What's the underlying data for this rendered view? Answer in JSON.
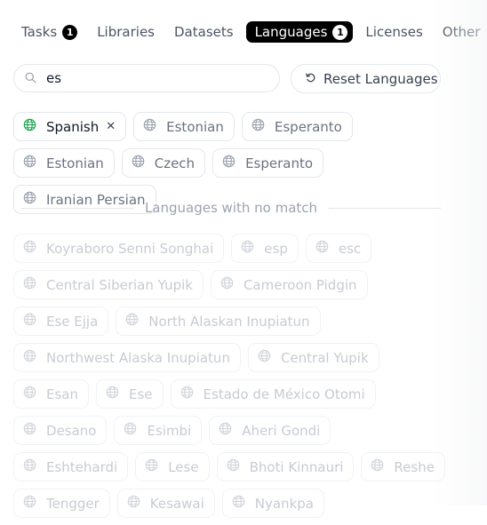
{
  "tabs": [
    {
      "label": "Tasks",
      "badge": "1",
      "active": false
    },
    {
      "label": "Libraries",
      "active": false
    },
    {
      "label": "Datasets",
      "active": false
    },
    {
      "label": "Languages",
      "badge": "1",
      "active": true
    },
    {
      "label": "Licenses",
      "active": false
    },
    {
      "label": "Other",
      "active": false
    }
  ],
  "search": {
    "value": "es",
    "icon": "search-icon"
  },
  "reset_button": {
    "label": "Reset Languages",
    "icon": "reset-icon"
  },
  "matched_languages": [
    {
      "label": "Spanish",
      "selected": true
    },
    {
      "label": "Estonian"
    },
    {
      "label": "Esperanto"
    },
    {
      "label": "Estonian"
    },
    {
      "label": "Czech"
    },
    {
      "label": "Esperanto"
    },
    {
      "label": "Iranian Persian"
    }
  ],
  "no_match": {
    "label": "Languages with no match",
    "items": [
      "Koyraboro Senni Songhai",
      "esp",
      "esc",
      "Central Siberian Yupik",
      "Cameroon Pidgin",
      "Ese Ejja",
      "North Alaskan Inupiatun",
      "Northwest Alaska Inupiatun",
      "Central Yupik",
      "Esan",
      "Ese",
      "Estado de México Otomi",
      "Desano",
      "Esimbi",
      "Aheri Gondi",
      "Eshtehardi",
      "Lese",
      "Bhoti Kinnauri",
      "Reshe",
      "Tengger",
      "Kesawai",
      "Nyankpa"
    ]
  },
  "colors": {
    "active_tab_bg": "#000000",
    "selected_globe": "#16a34a",
    "muted_globe": "#9ca3af"
  }
}
